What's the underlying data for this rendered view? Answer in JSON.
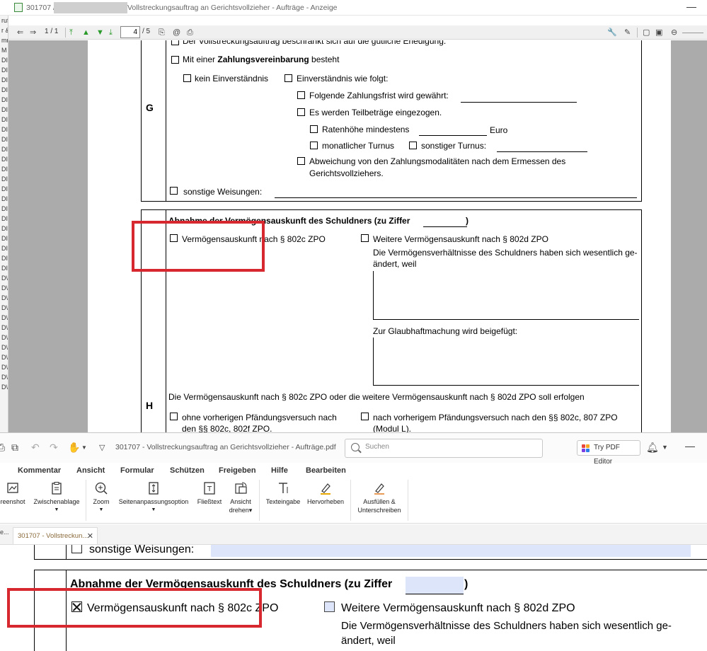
{
  "top_window": {
    "title_prefix": "301707 /",
    "title_suffix": "Vollstreckungsauftrag an Gerichtsvollzieher - Aufträge - Anzeige",
    "left_list": [
      "ruf",
      "r &",
      "mm",
      "M",
      "DI",
      "DI",
      "DI",
      "DI",
      "DI",
      "DI",
      "DI",
      "DI",
      "DI",
      "DI",
      "DI",
      "DI",
      "DI",
      "DI",
      "DI",
      "DI",
      "DI",
      "DI",
      "DI",
      "DI",
      "DI",
      "DI",
      "D\\",
      "D\\",
      "D\\",
      "D\\",
      "D\\",
      "D\\",
      "D\\",
      "D\\",
      "D\\",
      "D\\",
      "D\\",
      "D\\"
    ],
    "toolbar": {
      "page_count": "1 / 1",
      "page_current": "4",
      "page_total": "/ 5"
    },
    "page": {
      "row_top_cut": "Der Vollstreckungsauftrag beschränkt sich auf die gütliche Erledigung.",
      "g_letter": "G",
      "g_zahlung_pre": "Mit einer ",
      "g_zahlung_bold": "Zahlungsvereinbarung",
      "g_zahlung_post": " besteht",
      "g_kein": "kein Einverständnis",
      "g_einv": "Einverständnis wie folgt:",
      "g_frist": "Folgende Zahlungsfrist wird gewährt:",
      "g_teil": "Es werden Teilbeträge eingezogen.",
      "g_raten": "Ratenhöhe mindestens",
      "g_euro": "Euro",
      "g_monat": "monatlicher Turnus",
      "g_sonst_turnus": "sonstiger Turnus:",
      "g_abw_1": "Abweichung von den Zahlungsmodalitäten nach dem Ermessen des",
      "g_abw_2": "Gerichtsvollziehers.",
      "g_sonst_weis": "sonstige Weisungen:",
      "h_letter": "H",
      "h_heading": "Abnahme der Vermögensauskunft des Schuldners (zu Ziffer",
      "h_heading_close": ")",
      "h_opt1": "Vermögensauskunft nach § 802c ZPO",
      "h_opt2": "Weitere Vermögensauskunft nach § 802d ZPO",
      "h_opt2_desc_1": "Die Vermögensverhältnisse des Schuldners haben sich wesentlich ge-",
      "h_opt2_desc_2": "ändert, weil",
      "h_glaub": "Zur Glaubhaftmachung wird beigefügt:",
      "h_soll": "Die Vermögensauskunft nach § 802c ZPO oder die weitere Vermögensauskunft nach § 802d ZPO soll erfolgen",
      "h_ohne_1": "ohne vorherigen Pfändungsversuch nach",
      "h_ohne_2": "den §§ 802c, 802f ZPO.",
      "h_nach_1": "nach vorherigem Pfändungsversuch nach den §§ 802c, 807 ZPO",
      "h_nach_2": "(Modul L)."
    }
  },
  "bottom_window": {
    "title": "301707 - Vollstreckungsauftrag an Gerichtsvollzieher - Aufträge.pdf",
    "search_placeholder": "Suchen",
    "try_button": "Try PDF Editor",
    "menu": [
      "Kommentar",
      "Ansicht",
      "Formular",
      "Schützen",
      "Freigeben",
      "Hilfe",
      "Bearbeiten"
    ],
    "ribbon": {
      "screenshot": "reenshot",
      "zwischenablage": "Zwischenablage",
      "zoom": "Zoom",
      "seitenanpassung": "Seitenanpassungsoption",
      "fliesstext": "Fließtext",
      "ansicht_1": "Ansicht",
      "ansicht_2": "drehen",
      "texteingabe": "Texteingabe",
      "hervorheben": "Hervorheben",
      "ausfuellen_1": "Ausfüllen &",
      "ausfuellen_2": "Unterschreiben"
    },
    "tabs": {
      "prev": "e...",
      "active": "301707 - Vollstreckun..."
    },
    "doc": {
      "sonst_weis": "sonstige Weisungen:",
      "h_heading": "Abnahme der Vermögensauskunft des Schuldners (zu Ziffer",
      "h_heading_close": ")",
      "opt1": "Vermögensauskunft nach § 802c ZPO",
      "opt2": "Weitere Vermögensauskunft nach § 802d ZPO",
      "desc_1": "Die Vermögensverhältnisse des Schuldners haben sich wesentlich ge-",
      "desc_2": "ändert, weil"
    }
  },
  "colors": {
    "highlight_red": "#d7282f",
    "form_field_blue": "#dde5fb",
    "viewer_gray": "#ababab"
  }
}
